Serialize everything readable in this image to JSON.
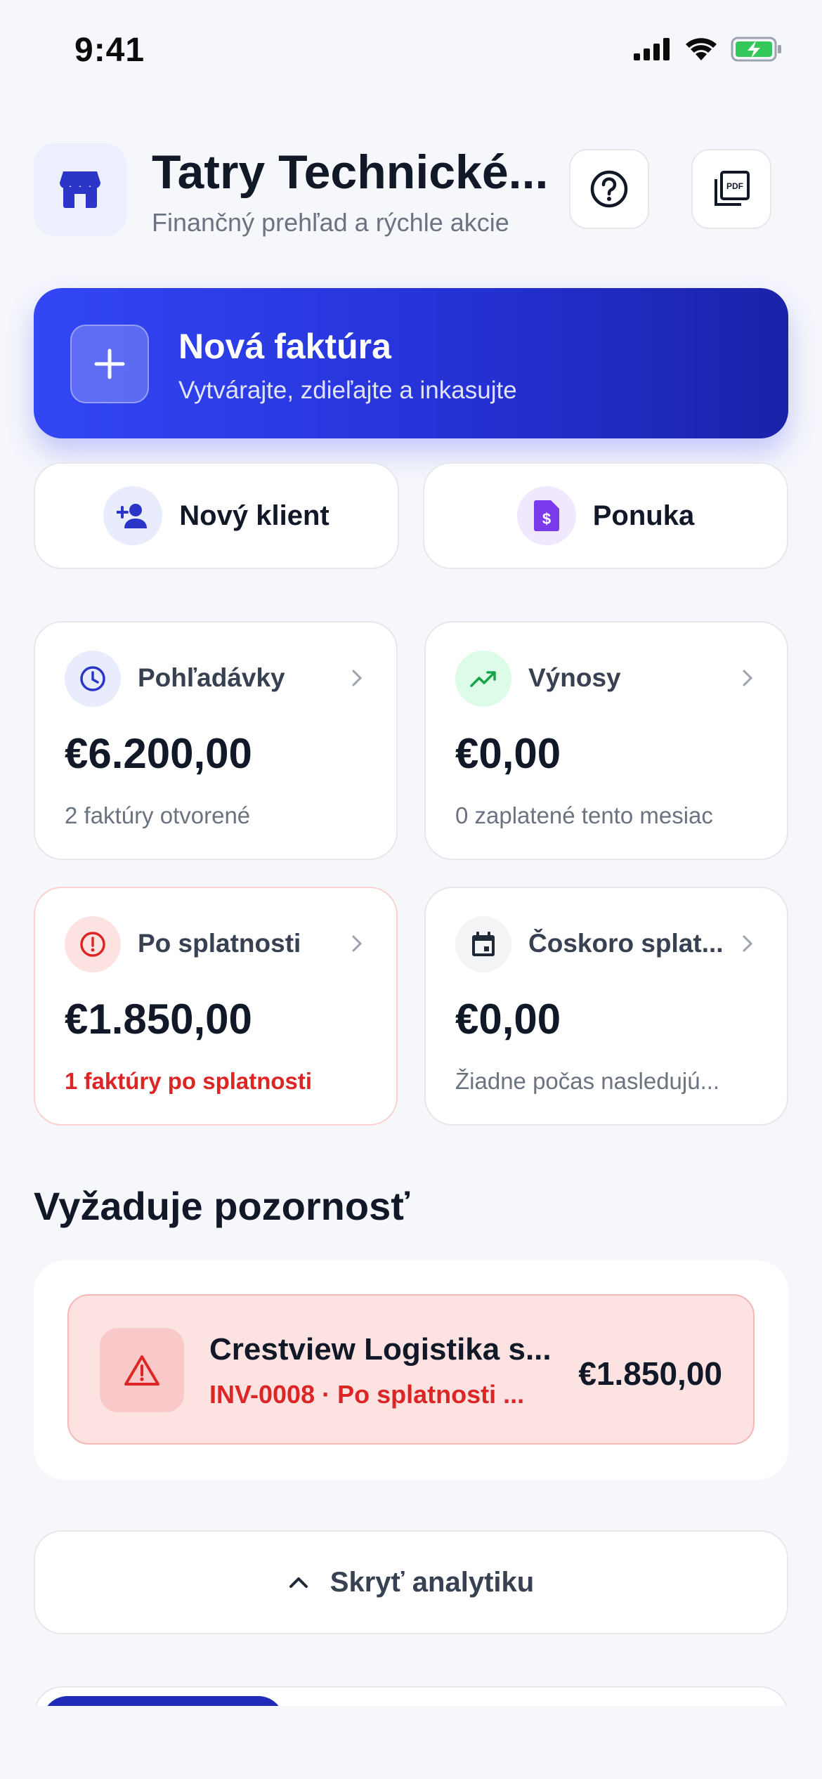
{
  "status_bar": {
    "time": "9:41"
  },
  "header": {
    "company_name": "Tatry Technické...",
    "subtitle": "Finančný prehľad a rýchle akcie"
  },
  "primary_action": {
    "title": "Nová faktúra",
    "subtitle": "Vytvárajte, zdieľajte a inkasujte"
  },
  "secondary_actions": [
    {
      "label": "Nový klient",
      "icon": "add-user-icon"
    },
    {
      "label": "Ponuka",
      "icon": "quote-document-icon"
    }
  ],
  "stats": [
    {
      "title": "Pohľadávky",
      "amount": "€6.200,00",
      "note": "2 faktúry otvorené",
      "icon": "clock-icon"
    },
    {
      "title": "Výnosy",
      "amount": "€0,00",
      "note": "0 zaplatené tento mesiac",
      "icon": "trend-up-icon"
    },
    {
      "title": "Po splatnosti",
      "amount": "€1.850,00",
      "note": "1 faktúry po splatnosti",
      "icon": "alert-circle-icon"
    },
    {
      "title": "Čoskoro splat...",
      "amount": "€0,00",
      "note": "Žiadne počas nasledujú...",
      "icon": "calendar-icon"
    }
  ],
  "attention": {
    "title": "Vyžaduje pozornosť",
    "items": [
      {
        "client": "Crestview Logistika s...",
        "detail": "INV-0008 · Po splatnosti ...",
        "amount": "€1.850,00",
        "icon": "warning-triangle-icon"
      }
    ]
  },
  "analytics_toggle": {
    "label": "Skryť analytiku"
  },
  "colors": {
    "accent": "#3347F5",
    "danger": "#DC2626",
    "success": "#22A06B",
    "purple": "#7C3AED"
  }
}
